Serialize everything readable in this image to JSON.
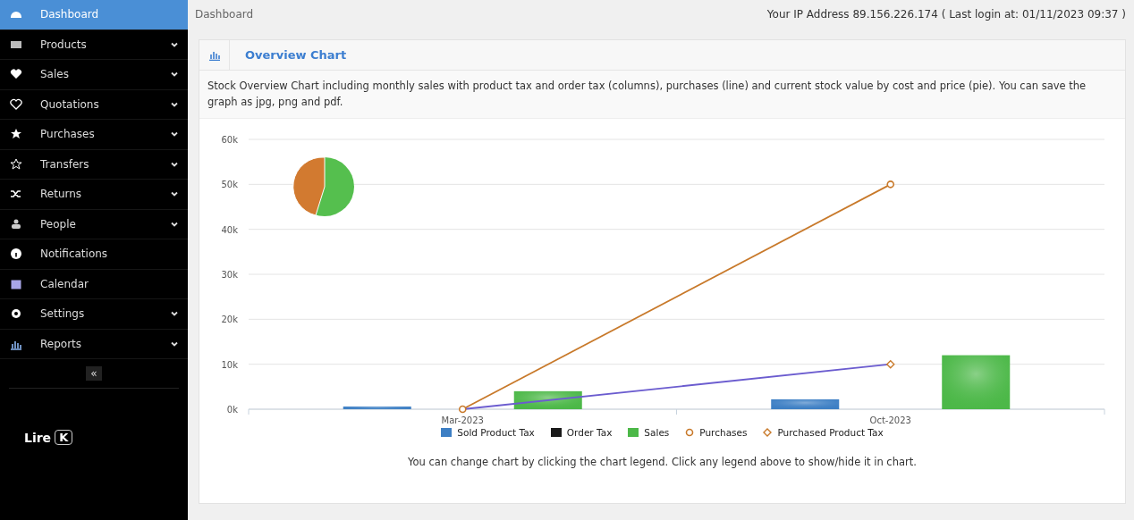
{
  "sidebar": {
    "items": [
      {
        "label": "Dashboard",
        "selected": true,
        "expandable": false
      },
      {
        "label": "Products",
        "selected": false,
        "expandable": true
      },
      {
        "label": "Sales",
        "selected": false,
        "expandable": true
      },
      {
        "label": "Quotations",
        "selected": false,
        "expandable": true
      },
      {
        "label": "Purchases",
        "selected": false,
        "expandable": true
      },
      {
        "label": "Transfers",
        "selected": false,
        "expandable": true
      },
      {
        "label": "Returns",
        "selected": false,
        "expandable": true
      },
      {
        "label": "People",
        "selected": false,
        "expandable": true
      },
      {
        "label": "Notifications",
        "selected": false,
        "expandable": false
      },
      {
        "label": "Calendar",
        "selected": false,
        "expandable": false
      },
      {
        "label": "Settings",
        "selected": false,
        "expandable": true
      },
      {
        "label": "Reports",
        "selected": false,
        "expandable": true
      }
    ],
    "collapse": "«"
  },
  "player_hint": {
    "label": "Lire",
    "key": "K"
  },
  "topbar": {
    "breadcrumb": "Dashboard",
    "info": "Your IP Address 89.156.226.174 ( Last login at: 01/11/2023 09:37 )"
  },
  "card": {
    "title": "Overview Chart",
    "description": "Stock Overview Chart including monthly sales with product tax and order tax (columns), purchases (line) and current stock value by cost and price (pie). You can save the graph as jpg, png and pdf.",
    "chart_data": {
      "type": "bar",
      "categories": [
        "Mar-2023",
        "Oct-2023"
      ],
      "ylim": [
        0,
        60000
      ],
      "yticks": [
        {
          "value": 0,
          "label": "0k"
        },
        {
          "value": 10000,
          "label": "10k"
        },
        {
          "value": 20000,
          "label": "20k"
        },
        {
          "value": 30000,
          "label": "30k"
        },
        {
          "value": 40000,
          "label": "40k"
        },
        {
          "value": 50000,
          "label": "50k"
        },
        {
          "value": 60000,
          "label": "60k"
        }
      ],
      "series": [
        {
          "name": "Sold Product Tax",
          "type": "bar",
          "color": "#3d7fc4",
          "values": [
            600,
            2200
          ]
        },
        {
          "name": "Order Tax",
          "type": "bar",
          "color": "#1a1a1a",
          "values": [
            0,
            0
          ]
        },
        {
          "name": "Sales",
          "type": "bar",
          "color": "#4cb848",
          "values": [
            4000,
            12000
          ]
        },
        {
          "name": "Purchases",
          "type": "line",
          "color": "#c8792a",
          "marker": "circle",
          "values": [
            0,
            50000
          ]
        },
        {
          "name": "Purchased Product Tax",
          "type": "line",
          "color": "#6b5ccf",
          "marker": "diamond",
          "values": [
            0,
            10000
          ]
        }
      ],
      "stacked": false,
      "grid": true,
      "legend": true
    },
    "note": "You can change chart by clicking the chart legend. Click any legend above to show/hide it in chart."
  }
}
